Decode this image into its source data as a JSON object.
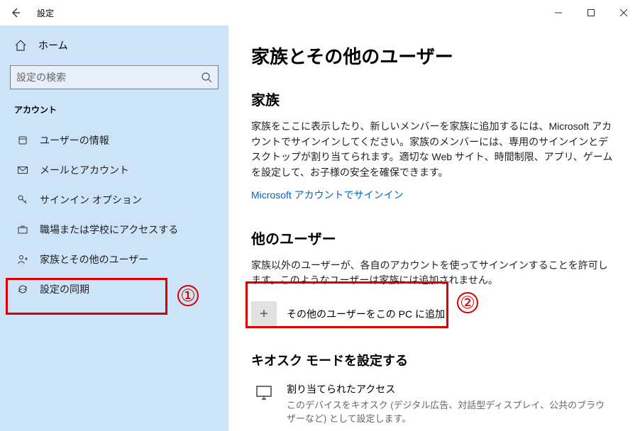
{
  "titlebar": {
    "title": "設定"
  },
  "sidebar": {
    "home": "ホーム",
    "search_placeholder": "設定の検索",
    "section": "アカウント",
    "items": [
      {
        "label": "ユーザーの情報"
      },
      {
        "label": "メールとアカウント"
      },
      {
        "label": "サインイン オプション"
      },
      {
        "label": "職場または学校にアクセスする"
      },
      {
        "label": "家族とその他のユーザー"
      },
      {
        "label": "設定の同期"
      }
    ]
  },
  "main": {
    "page_title": "家族とその他のユーザー",
    "family_heading": "家族",
    "family_body": "家族をここに表示したり、新しいメンバーを家族に追加するには、Microsoft アカウントでサインインしてください。家族のメンバーには、専用のサインインとデスクトップが割り当てられます。適切な Web サイト、時間制限、アプリ、ゲームを設定して、お子様の安全を確保できます。",
    "family_link": "Microsoft アカウントでサインイン",
    "other_heading": "他のユーザー",
    "other_body": "家族以外のユーザーが、各自のアカウントを使ってサインインすることを許可します。このようなユーザーは家族には追加されません。",
    "add_label": "その他のユーザーをこの PC に追加",
    "kiosk_heading": "キオスク モードを設定する",
    "kiosk_title": "割り当てられたアクセス",
    "kiosk_desc": "このデバイスをキオスク (デジタル広告、対話型ディスプレイ、公共のブラウザーなど) として設定します。"
  },
  "annotations": {
    "one": "①",
    "two": "②"
  }
}
